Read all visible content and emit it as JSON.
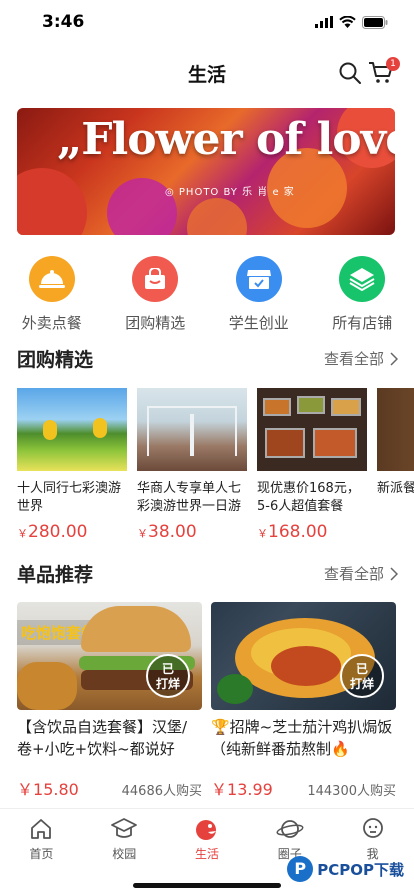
{
  "status_bar": {
    "time": "3:46"
  },
  "nav": {
    "title": "生活",
    "cart_badge": "1"
  },
  "banner": {
    "title": "„Flower of love",
    "subtitle": "◎ PHOTO BY 乐 肖 e 家"
  },
  "categories": [
    {
      "label": "外卖点餐",
      "icon": "cloche-icon",
      "color": "#f6a623"
    },
    {
      "label": "团购精选",
      "icon": "basket-icon",
      "color": "#f05a4f"
    },
    {
      "label": "学生创业",
      "icon": "storefront-icon",
      "color": "#3a8ef0"
    },
    {
      "label": "所有店铺",
      "icon": "layers-icon",
      "color": "#17c36b"
    }
  ],
  "group_section": {
    "title": "团购精选",
    "more": "查看全部"
  },
  "group_items": [
    {
      "name": "十人同行七彩澳游世界",
      "price": "280.00",
      "currency": "￥"
    },
    {
      "name": "华商人专享单人七彩澳游世界一日游",
      "price": "38.00",
      "currency": "￥"
    },
    {
      "name": "现优惠价168元，5-6人超值套餐",
      "price": "168.00",
      "currency": "￥"
    },
    {
      "name": "新派餐厅",
      "price": "",
      "currency": ""
    }
  ],
  "single_section": {
    "title": "单品推荐",
    "more": "查看全部"
  },
  "single_items": [
    {
      "name": "【含饮品自选套餐】汉堡/卷+小吃+饮料~都说好吃...",
      "price": "15.80",
      "currency": "￥",
      "sold": "44686人购买",
      "stamp": "已\n打烊",
      "overlay": "吃饱饱套餐"
    },
    {
      "name": "🏆招牌~芝士茄汁鸡扒焗饭（纯新鲜番茄熬制🔥",
      "price": "13.99",
      "currency": "￥",
      "sold": "144300人购买",
      "stamp": "已\n打烊",
      "overlay": ""
    }
  ],
  "tabbar": [
    {
      "label": "首页",
      "icon": "home-icon"
    },
    {
      "label": "校园",
      "icon": "graduation-cap-icon"
    },
    {
      "label": "生活",
      "icon": "life-icon",
      "active": true
    },
    {
      "label": "圈子",
      "icon": "planet-icon"
    },
    {
      "label": "我",
      "icon": "profile-icon"
    }
  ],
  "watermark": {
    "text": "PCPOP下载",
    "letter": "P"
  },
  "colors": {
    "accent": "#e5423e"
  }
}
